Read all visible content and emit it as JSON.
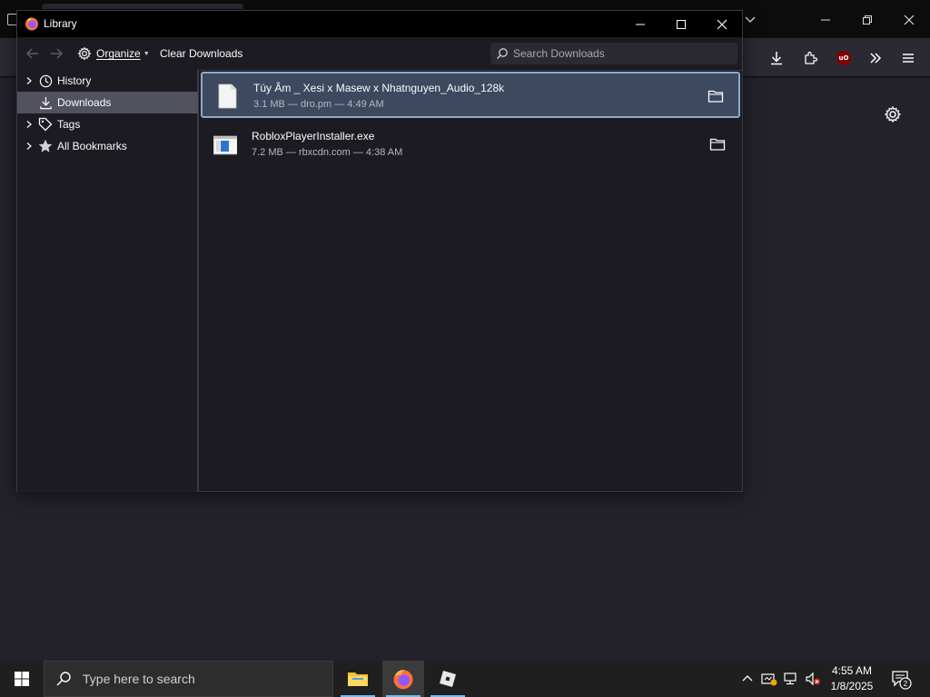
{
  "library": {
    "title": "Library",
    "toolbar": {
      "organize_label": "Organize",
      "clear_label": "Clear Downloads",
      "search_placeholder": "Search Downloads"
    },
    "sidebar": [
      {
        "label": "History",
        "icon": "clock-icon",
        "expandable": true
      },
      {
        "label": "Downloads",
        "icon": "download-icon",
        "expandable": false,
        "selected": true
      },
      {
        "label": "Tags",
        "icon": "tag-icon",
        "expandable": true
      },
      {
        "label": "All Bookmarks",
        "icon": "star-icon",
        "expandable": true
      }
    ],
    "downloads": [
      {
        "name": "Túy Âm _ Xesi x Masew x Nhatnguyen_Audio_128k",
        "meta": "3.1 MB — dro.pm — 4:49 AM",
        "icon": "file-icon",
        "selected": true
      },
      {
        "name": "RobloxPlayerInstaller.exe",
        "meta": "7.2 MB — rbxcdn.com — 4:38 AM",
        "icon": "exe-icon",
        "selected": false
      }
    ]
  },
  "taskbar": {
    "search_placeholder": "Type here to search",
    "time": "4:55 AM",
    "date": "1/8/2025",
    "notification_count": "2"
  },
  "colors": {
    "accent": "#76b9ed",
    "selection_bg": "#3c495f",
    "selection_border": "#8fa8c8",
    "sidebar_selected": "#52525e"
  }
}
